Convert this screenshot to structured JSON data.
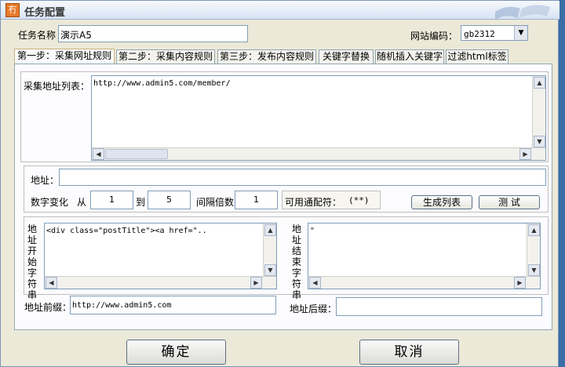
{
  "window": {
    "title": "任务配置",
    "icon": "task-config-icon",
    "icon_glyph": "冇"
  },
  "task": {
    "name_label": "任务名称",
    "name_value": "演示A5"
  },
  "encoding": {
    "label": "网站编码：",
    "value": "gb2312"
  },
  "tabs": [
    {
      "label": "第一步：采集网址规则",
      "active": true
    },
    {
      "label": "第二步：采集内容规则",
      "active": false
    },
    {
      "label": "第三步：发布内容规则",
      "active": false
    },
    {
      "label": "关键字替换",
      "active": false
    },
    {
      "label": "随机插入关键字",
      "active": false
    },
    {
      "label": "过滤html标签",
      "active": false
    }
  ],
  "collect": {
    "list_label": "采集地址列表：",
    "list_items": [
      "http://www.admin5.com/member/"
    ]
  },
  "address": {
    "label": "地址：",
    "value": "",
    "numeric_label": "数字变化",
    "from_label": "从",
    "from_value": "1",
    "to_label": "到",
    "to_value": "5",
    "interval_label": "间隔倍数",
    "interval_value": "1",
    "wildcard_label": "可用通配符：",
    "wildcard_value": "(**)",
    "generate_button": "生成列表",
    "test_button": "测 试"
  },
  "boundaries": {
    "start_label": "地址开始字符串",
    "start_value": "<div class=\"postTitle\"><a href=\"..",
    "end_label": "地址结束字符串",
    "end_value": "\""
  },
  "prefix": {
    "label": "地址前缀：",
    "value": "http://www.admin5.com"
  },
  "suffix": {
    "label": "地址后缀：",
    "value": ""
  },
  "footer": {
    "ok_button": "确定",
    "cancel_button": "取消"
  },
  "colors": {
    "desktop": "#3a6ea5",
    "window_bg": "#ece9d8",
    "panel_bg": "#fcfcfe",
    "border": "#7f9db9"
  }
}
